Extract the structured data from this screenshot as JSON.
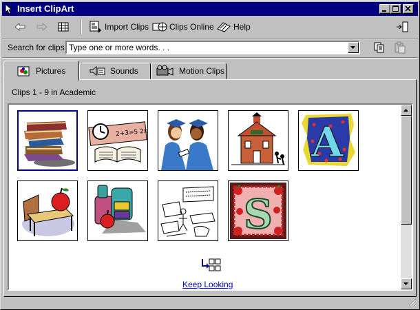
{
  "window": {
    "title": "Insert ClipArt"
  },
  "toolbar": {
    "import_label": "Import Clips",
    "online_label": "Clips Online",
    "help_label": "Help"
  },
  "search": {
    "label": "Search for clips:",
    "value": "Type one or more words. . ."
  },
  "tabs": [
    {
      "label": "Pictures",
      "active": true
    },
    {
      "label": "Sounds",
      "active": false
    },
    {
      "label": "Motion Clips",
      "active": false
    }
  ],
  "gallery": {
    "caption": "Clips 1 - 9 in Academic",
    "clips": [
      {
        "icon": "stack-of-books"
      },
      {
        "icon": "clock-and-book"
      },
      {
        "icon": "graduates"
      },
      {
        "icon": "schoolhouse"
      },
      {
        "icon": "letter-a"
      },
      {
        "icon": "school-desk-apple"
      },
      {
        "icon": "backpack-apple"
      },
      {
        "icon": "classroom-sketch"
      },
      {
        "icon": "letter-s-strawberries"
      }
    ],
    "keep_looking": "Keep Looking"
  },
  "colors": {
    "title_bar": "#000080",
    "link": "#0000cc",
    "face": "#c0c0c0"
  }
}
